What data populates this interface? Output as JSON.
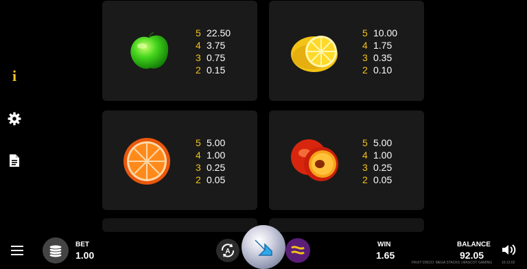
{
  "sidebar": {
    "info_glyph": "i",
    "icons": [
      "info-icon",
      "gear-icon",
      "document-icon"
    ]
  },
  "paytable": [
    {
      "fruit": "green-apple",
      "rows": [
        {
          "count": "5",
          "amount": "22.50"
        },
        {
          "count": "4",
          "amount": "3.75"
        },
        {
          "count": "3",
          "amount": "0.75"
        },
        {
          "count": "2",
          "amount": "0.15"
        }
      ]
    },
    {
      "fruit": "lemon",
      "rows": [
        {
          "count": "5",
          "amount": "10.00"
        },
        {
          "count": "4",
          "amount": "1.75"
        },
        {
          "count": "3",
          "amount": "0.35"
        },
        {
          "count": "2",
          "amount": "0.10"
        }
      ]
    },
    {
      "fruit": "orange",
      "rows": [
        {
          "count": "5",
          "amount": "5.00"
        },
        {
          "count": "4",
          "amount": "1.00"
        },
        {
          "count": "3",
          "amount": "0.25"
        },
        {
          "count": "2",
          "amount": "0.05"
        }
      ]
    },
    {
      "fruit": "peach",
      "rows": [
        {
          "count": "5",
          "amount": "5.00"
        },
        {
          "count": "4",
          "amount": "1.00"
        },
        {
          "count": "3",
          "amount": "0.25"
        },
        {
          "count": "2",
          "amount": "0.05"
        }
      ]
    }
  ],
  "bottom_bar": {
    "bet_label": "BET",
    "bet_value": "1.00",
    "win_label": "WIN",
    "win_value": "1.65",
    "balance_label": "BALANCE",
    "balance_value": "92.05",
    "footer_text": "FRUIT DISCO: MEGA STACKS | MASCOT GAMING",
    "clock": "16:12:02"
  },
  "colors": {
    "accent": "#f2c21b",
    "card_bg": "#1a1a1a",
    "background": "#000000",
    "turbo": "#5b1e78"
  }
}
